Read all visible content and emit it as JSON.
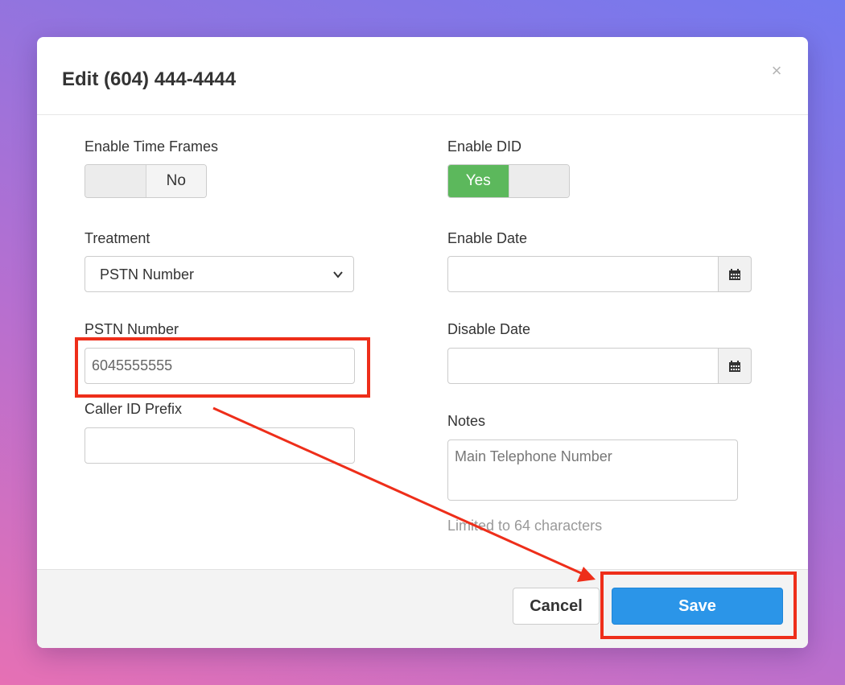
{
  "dialog": {
    "title": "Edit (604) 444-4444",
    "close_glyph": "×"
  },
  "fields": {
    "enable_time_frames": {
      "label": "Enable Time Frames",
      "state": "No"
    },
    "enable_did": {
      "label": "Enable DID",
      "state": "Yes"
    },
    "treatment": {
      "label": "Treatment",
      "value": "PSTN Number"
    },
    "enable_date": {
      "label": "Enable Date",
      "value": ""
    },
    "pstn_number": {
      "label": "PSTN Number",
      "value": "6045555555"
    },
    "disable_date": {
      "label": "Disable Date",
      "value": ""
    },
    "caller_id_prefix": {
      "label": "Caller ID Prefix",
      "value": ""
    },
    "notes": {
      "label": "Notes",
      "value": "Main Telephone Number",
      "help": "Limited to 64 characters"
    }
  },
  "footer": {
    "cancel_label": "Cancel",
    "save_label": "Save"
  },
  "icons": {
    "calendar": "calendar-icon",
    "chevron": "chevron-down-icon",
    "close": "close-icon"
  },
  "colors": {
    "toggle_on": "#5cb85c",
    "save_button": "#2b95e8",
    "annotation": "#ee2e1a"
  }
}
